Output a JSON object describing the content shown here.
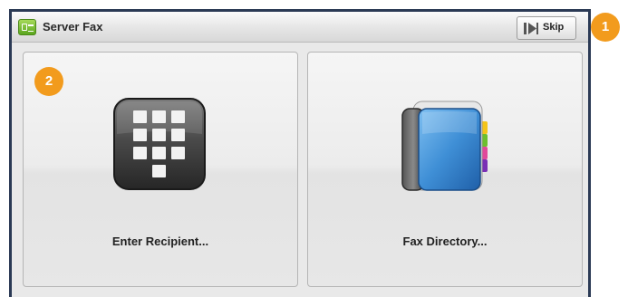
{
  "header": {
    "title": "Server Fax",
    "icon": "server-fax-app-icon",
    "skip_label": "Skip",
    "skip_icon": "skip-forward-icon"
  },
  "tiles": [
    {
      "label": "Enter Recipient...",
      "icon": "keypad-icon"
    },
    {
      "label": "Fax Directory...",
      "icon": "address-book-icon"
    }
  ],
  "callouts": [
    "1",
    "2"
  ],
  "colors": {
    "frame": "#2b3a55",
    "callout": "#f29b1d",
    "app_icon": "#5aa51e",
    "book": "#3f8fd6"
  }
}
